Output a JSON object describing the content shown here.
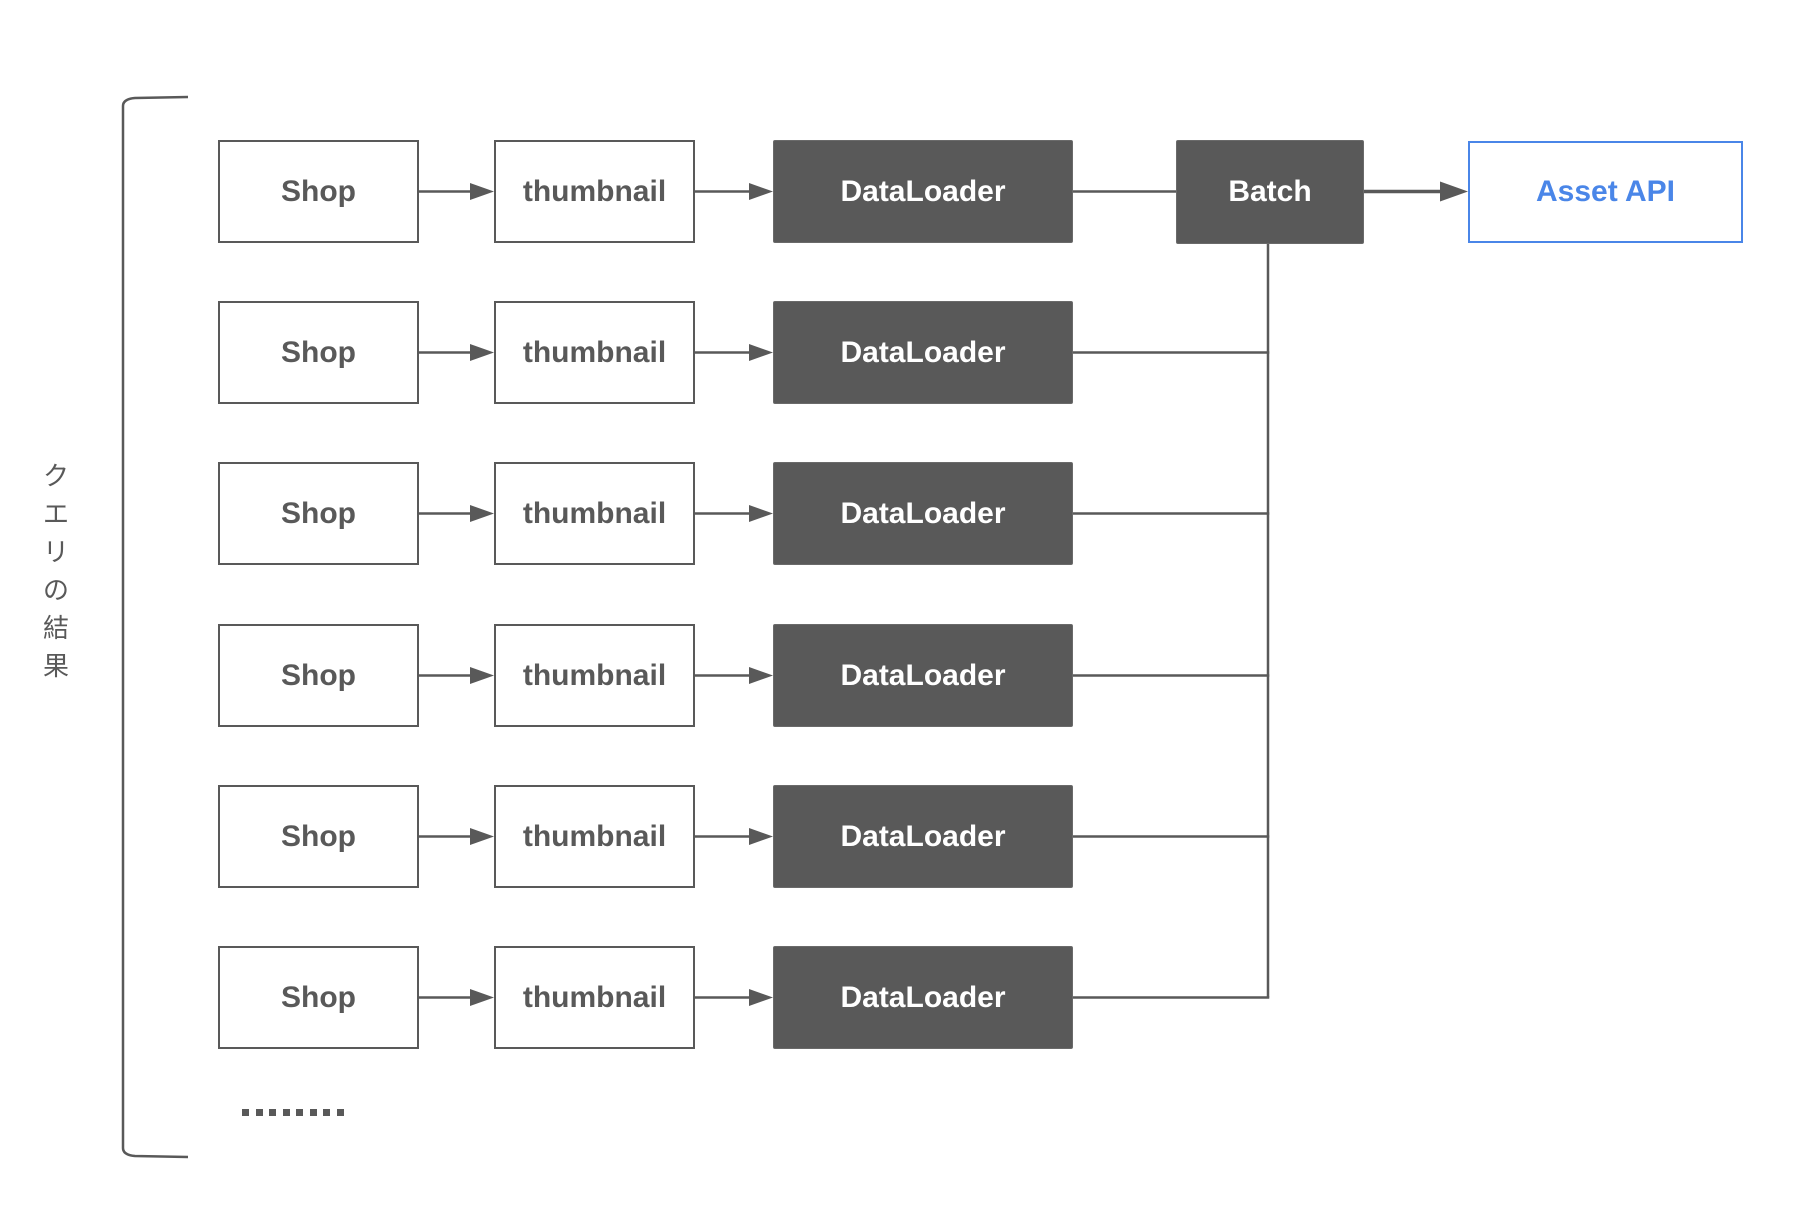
{
  "diagram": {
    "side_label": "クエリの結果",
    "side_label_chars": [
      "ク",
      "エ",
      "リ",
      "の",
      "結",
      "果"
    ],
    "rows": [
      {
        "shop": "Shop",
        "field": "thumbnail",
        "loader": "DataLoader"
      },
      {
        "shop": "Shop",
        "field": "thumbnail",
        "loader": "DataLoader"
      },
      {
        "shop": "Shop",
        "field": "thumbnail",
        "loader": "DataLoader"
      },
      {
        "shop": "Shop",
        "field": "thumbnail",
        "loader": "DataLoader"
      },
      {
        "shop": "Shop",
        "field": "thumbnail",
        "loader": "DataLoader"
      },
      {
        "shop": "Shop",
        "field": "thumbnail",
        "loader": "DataLoader"
      }
    ],
    "batch_label": "Batch",
    "api_label": "Asset API",
    "ellipsis": "........",
    "colors": {
      "gray": "#595959",
      "blue": "#4a86e8",
      "background": "#ffffff"
    },
    "edges": [
      {
        "from": "Shop",
        "to": "thumbnail",
        "type": "arrow"
      },
      {
        "from": "thumbnail",
        "to": "DataLoader",
        "type": "arrow"
      },
      {
        "from": "DataLoader",
        "to": "Batch",
        "type": "line"
      },
      {
        "from": "Batch",
        "to": "Asset API",
        "type": "arrow"
      }
    ]
  }
}
